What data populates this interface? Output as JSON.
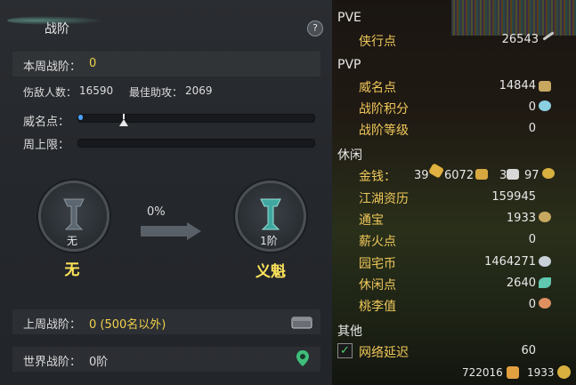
{
  "left_panel": {
    "title": "战阶",
    "help_icon": "?",
    "weekly_rank_label": "本周战阶：",
    "weekly_rank_value": "0",
    "enemies_label": "伤敌人数：",
    "enemies_value": "16590",
    "best_assist_label": "最佳助攻：",
    "best_assist_value": "2069",
    "prestige_label": "威名点：",
    "prestige_progress": 0.02,
    "weekly_cap_label": "周上限：",
    "weekly_cap_progress": 0,
    "current_medal": {
      "rank": "无",
      "name": "无"
    },
    "progress_pct": "0%",
    "next_medal": {
      "rank": "1阶",
      "name": "义魁"
    },
    "last_week_label": "上周战阶：",
    "last_week_value": "0 (500名以外)",
    "world_rank_label": "世界战阶：",
    "world_rank_value": "0阶"
  },
  "right_panel": {
    "pve": {
      "header": "PVE",
      "items": [
        {
          "label": "侠行点",
          "value": "26543"
        }
      ]
    },
    "pvp": {
      "header": "PVP",
      "items": [
        {
          "label": "威名点",
          "value": "14844"
        },
        {
          "label": "战阶积分",
          "value": "0"
        },
        {
          "label": "战阶等级",
          "value": "0"
        }
      ]
    },
    "leisure": {
      "header": "休闲",
      "money_label": "金钱：",
      "money_gold": "39",
      "money_silver": "6072",
      "money_copper_a": "3",
      "money_copper_b": "97",
      "items": [
        {
          "label": "江湖资历",
          "value": "159945"
        },
        {
          "label": "通宝",
          "value": "1933"
        },
        {
          "label": "薪火点",
          "value": "0"
        },
        {
          "label": "园宅币",
          "value": "1464271"
        },
        {
          "label": "休闲点",
          "value": "2640"
        },
        {
          "label": "桃李值",
          "value": "0"
        }
      ]
    },
    "other": {
      "header": "其他",
      "latency_label": "网络延迟",
      "latency_value": "60",
      "latency_checked": true
    },
    "footer": {
      "left_value": "722016",
      "right_value": "1933"
    }
  },
  "colors": {
    "accent_yellow": "#f2d24a",
    "label_gold": "#f0c85a",
    "progress_blue": "#4aa0ff"
  },
  "icons": [
    "help-icon",
    "swords-icon",
    "gold-ingot-icon",
    "silver-icon",
    "coin-icon",
    "crystal-icon",
    "token-icon",
    "spiral-icon",
    "leaf-icon",
    "peach-icon",
    "chest-icon",
    "location-icon",
    "cup-icon",
    "flag-icon"
  ]
}
